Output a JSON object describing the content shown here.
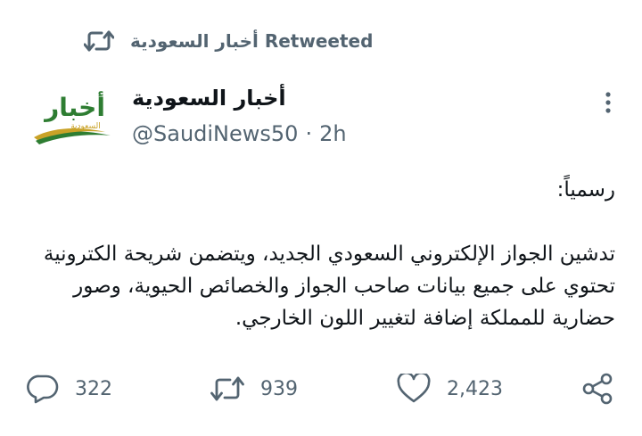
{
  "retweet_header": {
    "text": "أخبار السعودية Retweeted",
    "icon": "retweet-icon"
  },
  "author": {
    "name": "أخبار السعودية",
    "handle": "@SaudiNews50",
    "separator": "·",
    "time": "2h",
    "avatar_logo_text": "أخبار السعودية"
  },
  "tweet": {
    "line1": "رسمياً:",
    "line2": "تدشين الجواز الإلكتروني السعودي الجديد، ويتضمن شريحة الكترونية تحتوي على جميع بيانات صاحب الجواز والخصائص الحيوية، وصور حضارية للمملكة إضافة لتغيير اللون الخارجي."
  },
  "actions": {
    "reply_count": "322",
    "retweet_count": "939",
    "like_count": "2,423"
  },
  "icons": {
    "reply": "comment-icon",
    "retweet": "retweet-icon",
    "like": "heart-icon",
    "share": "share-icon",
    "more": "more-dots-icon"
  },
  "colors": {
    "text_primary": "#0f1419",
    "text_secondary": "#536471",
    "logo_green": "#2e7d32",
    "logo_gold": "#c9a227"
  }
}
